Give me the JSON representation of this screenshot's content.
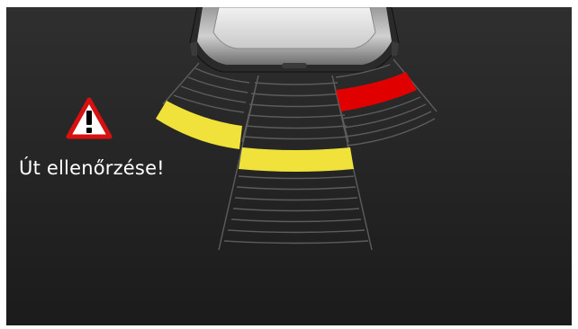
{
  "warning": {
    "message": "Út ellenőrzése!",
    "icon": "warning-triangle-icon"
  },
  "sensors": {
    "rear_left": {
      "status": "warning",
      "active_color": "#f0e23a"
    },
    "rear_center": {
      "status": "warning",
      "active_color": "#f0e23a"
    },
    "rear_right": {
      "status": "alert",
      "active_color": "#e00000"
    }
  },
  "colors": {
    "background": "#262626",
    "grid_lines": "#5c5c5c",
    "yellow": "#f0e23a",
    "red": "#e00000",
    "warning_icon_red": "#d81010"
  }
}
